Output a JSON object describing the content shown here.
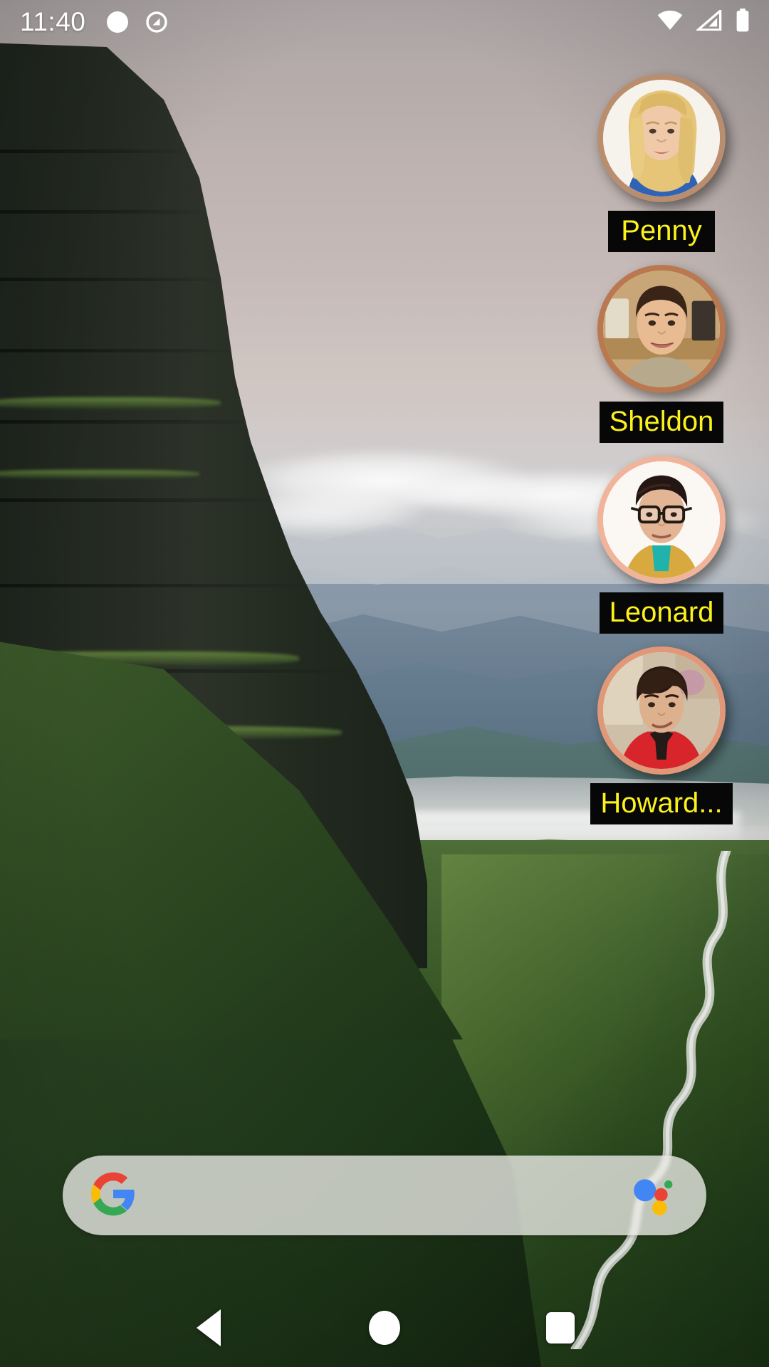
{
  "statusbar": {
    "time": "11:40",
    "left_icons": [
      {
        "name": "notification-dot-icon",
        "glyph": "circle"
      },
      {
        "name": "do-not-disturb-icon",
        "glyph": "circle-slash"
      }
    ],
    "right_icons": [
      {
        "name": "wifi-icon",
        "label": "Wi-Fi full signal"
      },
      {
        "name": "cellular-signal-icon",
        "label": "Mobile signal"
      },
      {
        "name": "battery-icon",
        "label": "Battery full"
      }
    ]
  },
  "widgets": {
    "type": "contact-shortcuts",
    "label_bg": "#070707",
    "label_fg": "#fbf11c",
    "items": [
      {
        "name": "Penny",
        "ring": "#b98e6f",
        "hair": "#e6c578",
        "skin": "#f0c9a8",
        "shirt": "#2f63b5",
        "bg": "#f6f2ec",
        "glasses": false
      },
      {
        "name": "Sheldon",
        "ring": "#b9784f",
        "hair": "#3a2418",
        "skin": "#e8bb93",
        "shirt": "#b7a98c",
        "bg": "#c9a678",
        "glasses": false
      },
      {
        "name": "Leonard",
        "ring": "#efb49a",
        "hair": "#241713",
        "skin": "#e3b595",
        "shirt": "#d8a93f",
        "bg": "#fbf8f4",
        "glasses": true
      },
      {
        "name": "Howard...",
        "ring": "#e09878",
        "hair": "#2a1a12",
        "skin": "#ddb08e",
        "shirt": "#d8252b",
        "bg": "#cdbfa8",
        "glasses": false
      }
    ]
  },
  "search": {
    "google_logo": "google-g-icon",
    "assistant": "google-assistant-icon",
    "colors": {
      "blue": "#4285f4",
      "red": "#ea4335",
      "yellow": "#fbbc05",
      "green": "#34a853"
    }
  },
  "navbar": {
    "buttons": [
      {
        "name": "back-button",
        "label": "Back"
      },
      {
        "name": "home-button",
        "label": "Home"
      },
      {
        "name": "recents-button",
        "label": "Recent apps"
      }
    ]
  }
}
